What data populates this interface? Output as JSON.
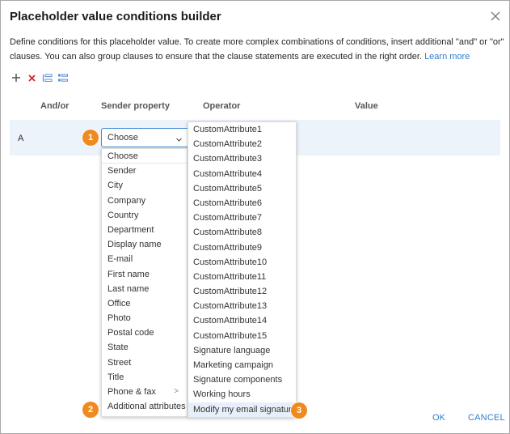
{
  "dialog": {
    "title": "Placeholder value conditions builder",
    "description": "Define conditions for this placeholder value. To create more complex combinations of conditions, insert additional \"and\" or \"or\" clauses. You can also group clauses to ensure that the clause statements are executed in the right order.",
    "learn_more": "Learn more"
  },
  "toolbar": {
    "icons": [
      "add-icon",
      "delete-icon",
      "group-icon",
      "ungroup-icon"
    ]
  },
  "table": {
    "headers": {
      "and_or": "And/or",
      "sender_property": "Sender property",
      "operator": "Operator",
      "value": "Value"
    },
    "row": {
      "label": "A",
      "selected_property": "Choose"
    }
  },
  "badges": [
    "1",
    "2",
    "3"
  ],
  "property_menu": {
    "items": [
      "Choose",
      "Sender",
      "City",
      "Company",
      "Country",
      "Department",
      "Display name",
      "E-mail",
      "First name",
      "Last name",
      "Office",
      "Photo",
      "Postal code",
      "State",
      "Street",
      "Title",
      "Phone & fax",
      "Additional attributes"
    ],
    "submenu_arrow": ">"
  },
  "attributes_menu": {
    "items": [
      "CustomAttribute1",
      "CustomAttribute2",
      "CustomAttribute3",
      "CustomAttribute4",
      "CustomAttribute5",
      "CustomAttribute6",
      "CustomAttribute7",
      "CustomAttribute8",
      "CustomAttribute9",
      "CustomAttribute10",
      "CustomAttribute11",
      "CustomAttribute12",
      "CustomAttribute13",
      "CustomAttribute14",
      "CustomAttribute15",
      "Signature language",
      "Marketing campaign",
      "Signature components",
      "Working hours",
      "Modify my email signature"
    ],
    "highlighted": "Modify my email signature"
  },
  "footer": {
    "ok": "OK",
    "cancel": "CANCEL"
  },
  "colors": {
    "accent": "#2f7fd0",
    "badge": "#ef8a1e",
    "delete": "#d9262b",
    "row_bg": "#edf3fb"
  }
}
